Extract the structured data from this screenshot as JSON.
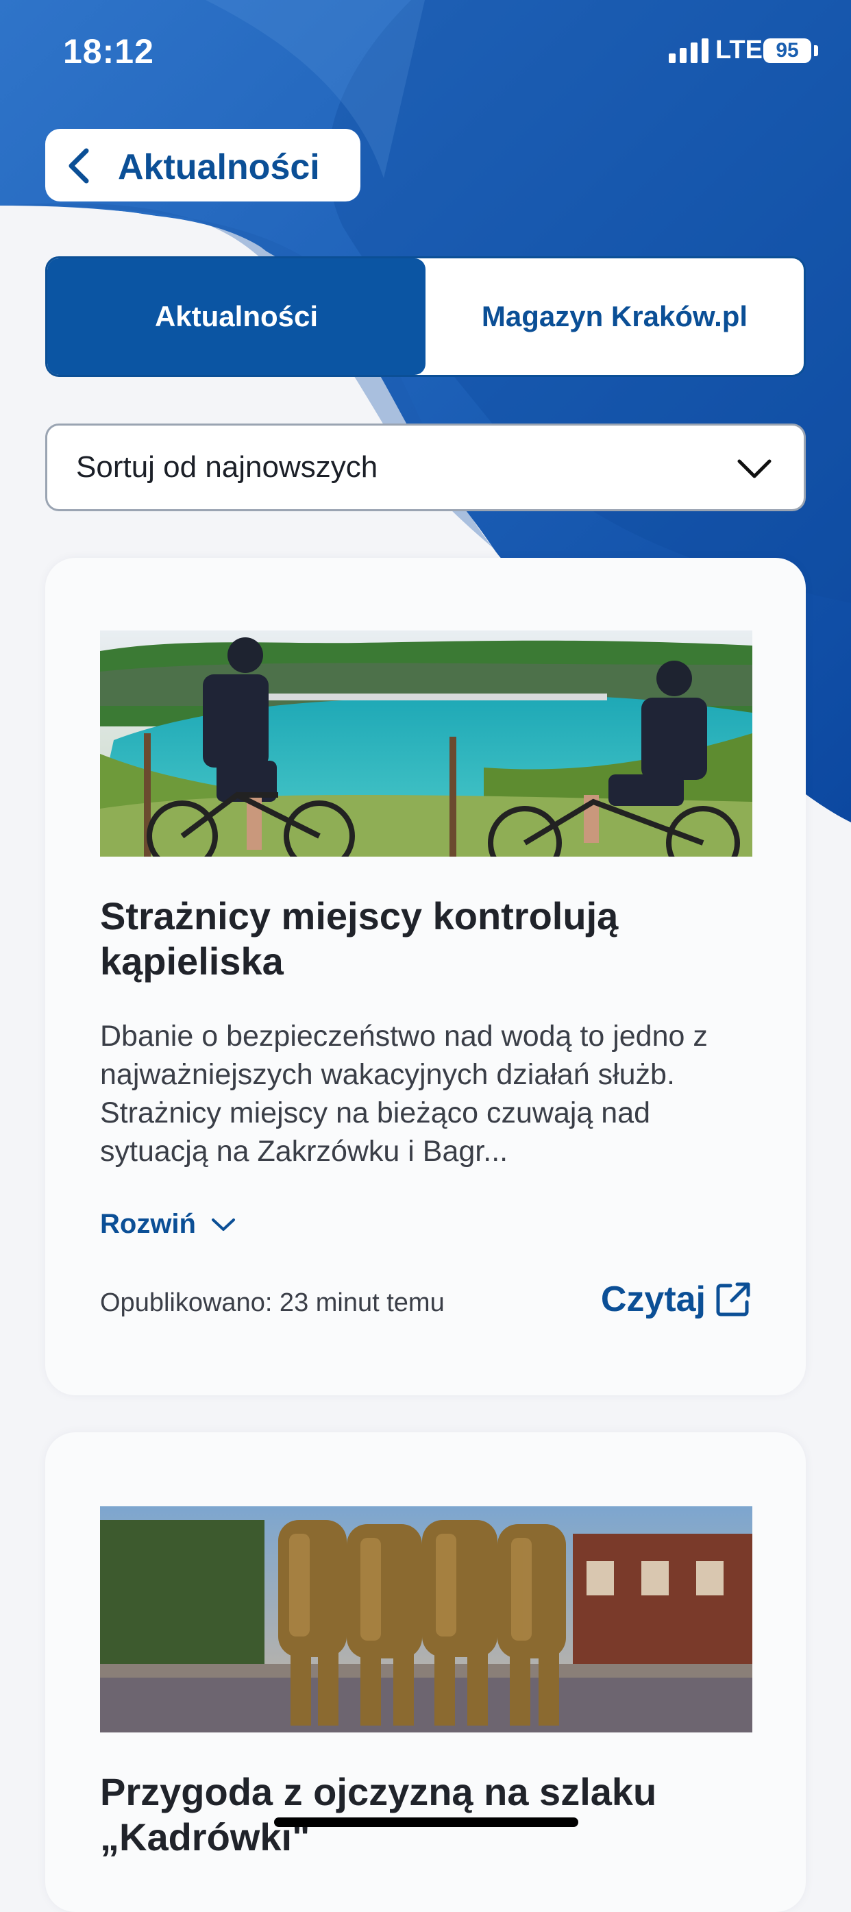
{
  "status_bar": {
    "time": "18:12",
    "network": "LTE",
    "battery": "95"
  },
  "header": {
    "back_label": "Aktualności"
  },
  "tabs": [
    {
      "label": "Aktualności",
      "active": true
    },
    {
      "label": "Magazyn Kraków.pl",
      "active": false
    }
  ],
  "sort": {
    "selected": "Sortuj od najnowszych"
  },
  "articles": [
    {
      "title": "Strażnicy miejscy kontrolują kąpieliska",
      "description": "Dbanie o bezpieczeństwo nad wodą to jedno z najważniejszych wakacyjnych działań służb. Strażnicy miejscy na bieżąco czuwają nad sytuacją na Zakrzówku i Bagr...",
      "expand_label": "Rozwiń",
      "published": "Opublikowano: 23 minut temu",
      "read_label": "Czytaj"
    },
    {
      "title": "Przygoda z ojczyzną na szlaku „Kadrówki\""
    }
  ],
  "colors": {
    "brand": "#0b4f96",
    "accent_dark": "#0a3f86"
  }
}
